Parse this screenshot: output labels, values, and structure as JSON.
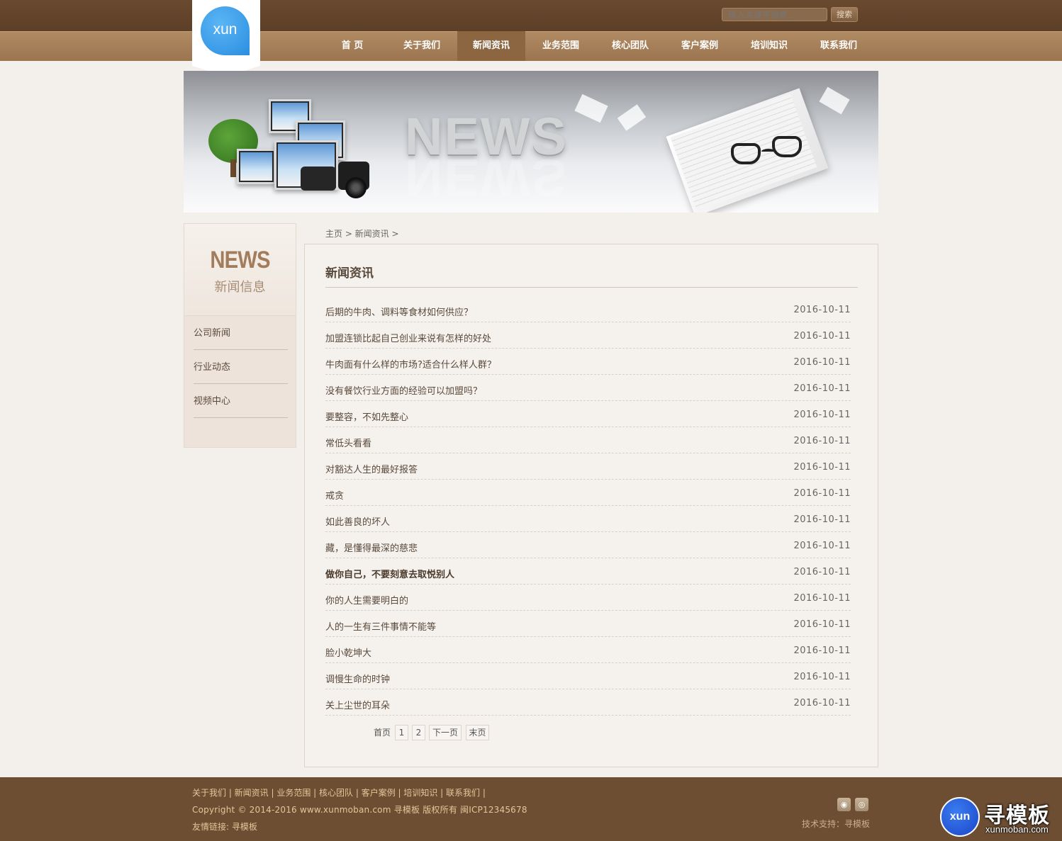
{
  "header": {
    "logo_text": "xun",
    "search": {
      "placeholder": "输入关键字搜索...",
      "button_label": "搜索"
    },
    "nav": [
      {
        "label": "首  页",
        "active": false
      },
      {
        "label": "关于我们",
        "active": false
      },
      {
        "label": "新闻资讯",
        "active": true
      },
      {
        "label": "业务范围",
        "active": false
      },
      {
        "label": "核心团队",
        "active": false
      },
      {
        "label": "客户案例",
        "active": false
      },
      {
        "label": "培训知识",
        "active": false
      },
      {
        "label": "联系我们",
        "active": false
      }
    ]
  },
  "banner": {
    "headline": "NEWS"
  },
  "sidebar": {
    "title_en": "NEWS",
    "title_cn": "新闻信息",
    "items": [
      {
        "label": "公司新闻"
      },
      {
        "label": "行业动态"
      },
      {
        "label": "视频中心"
      }
    ]
  },
  "main": {
    "breadcrumb": "主页 > 新闻资讯 >",
    "title": "新闻资讯",
    "news": [
      {
        "title": "后期的牛肉、调料等食材如何供应？",
        "date": "2016-10-11",
        "bold": false
      },
      {
        "title": "加盟连锁比起自己创业来说有怎样的好处",
        "date": "2016-10-11",
        "bold": false
      },
      {
        "title": "牛肉面有什么样的市场?适合什么样人群？",
        "date": "2016-10-11",
        "bold": false
      },
      {
        "title": "没有餐饮行业方面的经验可以加盟吗？",
        "date": "2016-10-11",
        "bold": false
      },
      {
        "title": "要整容，不如先整心",
        "date": "2016-10-11",
        "bold": false
      },
      {
        "title": "常低头看看",
        "date": "2016-10-11",
        "bold": false
      },
      {
        "title": "对豁达人生的最好报答",
        "date": "2016-10-11",
        "bold": false
      },
      {
        "title": "戒贪",
        "date": "2016-10-11",
        "bold": false
      },
      {
        "title": "如此善良的坏人",
        "date": "2016-10-11",
        "bold": false
      },
      {
        "title": "藏，是懂得最深的慈悲",
        "date": "2016-10-11",
        "bold": false
      },
      {
        "title": "做你自己，不要刻意去取悦别人",
        "date": "2016-10-11",
        "bold": true
      },
      {
        "title": "你的人生需要明白的",
        "date": "2016-10-11",
        "bold": false
      },
      {
        "title": "人的一生有三件事情不能等",
        "date": "2016-10-11",
        "bold": false
      },
      {
        "title": "脸小乾坤大",
        "date": "2016-10-11",
        "bold": false
      },
      {
        "title": "调慢生命的时钟",
        "date": "2016-10-11",
        "bold": false
      },
      {
        "title": "关上尘世的耳朵",
        "date": "2016-10-11",
        "bold": false
      }
    ],
    "pagination": {
      "first": "首页",
      "pages": [
        "1",
        "2"
      ],
      "next": "下一页",
      "last": "末页"
    }
  },
  "footer": {
    "links": "关于我们 | 新闻资讯 | 业务范围 | 核心团队 | 客户案例 | 培训知识 | 联系我们 |",
    "copyright": "Copyright © 2014-2016 www.xunmoban.com 寻模板 版权所有 闽ICP12345678",
    "friend_links": "友情链接: 寻模板",
    "support": "技术支持：寻模板",
    "icons": [
      "rss-icon",
      "weibo-icon"
    ]
  },
  "watermark": {
    "circle_text": "xun",
    "cn": "寻模板",
    "en": "xunmoban.com"
  },
  "colors": {
    "header_dark": "#5c3f27",
    "nav_bar": "#9b7550",
    "nav_active": "#8b6641",
    "page_bg": "#f3efea",
    "footer_bg": "#6e4e33",
    "footer_text": "#e4c698",
    "logo_blue": "#2a8ee0"
  }
}
